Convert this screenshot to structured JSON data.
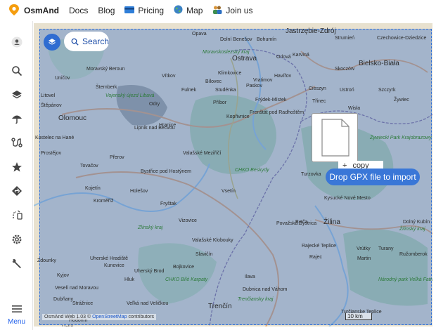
{
  "header": {
    "brand": "OsmAnd",
    "nav": [
      {
        "label": "Docs"
      },
      {
        "label": "Blog"
      },
      {
        "label": "Pricing"
      },
      {
        "label": "Map"
      },
      {
        "label": "Join us"
      }
    ]
  },
  "sidebar": {
    "menu_label": "Menu",
    "icons": [
      "account-icon",
      "search-icon",
      "layers-icon",
      "weather-icon",
      "routes-icon",
      "favorites-icon",
      "navigation-icon",
      "travel-icon",
      "settings-icon",
      "tools-icon"
    ]
  },
  "map": {
    "search_label": "Search",
    "copy_label": "copy",
    "drop_label": "Drop GPX file to import",
    "attribution_prefix": "OsmAnd Web 1.03 ©",
    "attribution_link": "OpenStreetMap",
    "attribution_suffix": "contributors",
    "scale_label": "10 km",
    "places": [
      {
        "name": "Opava",
        "cls": ""
      },
      {
        "name": "Dolní Benešov",
        "cls": ""
      },
      {
        "name": "Bohumín",
        "cls": ""
      },
      {
        "name": "Jastrzębie-Zdrój",
        "cls": "big"
      },
      {
        "name": "Strumień",
        "cls": ""
      },
      {
        "name": "Czechowice-Dziedzice",
        "cls": ""
      },
      {
        "name": "Moravskoslezský kraj",
        "cls": "park"
      },
      {
        "name": "Ostrava",
        "cls": "big"
      },
      {
        "name": "Orlová",
        "cls": ""
      },
      {
        "name": "Karviná",
        "cls": ""
      },
      {
        "name": "Bielsko-Biała",
        "cls": "big"
      },
      {
        "name": "Moravský Beroun",
        "cls": ""
      },
      {
        "name": "Vítkov",
        "cls": ""
      },
      {
        "name": "Klimkovice",
        "cls": ""
      },
      {
        "name": "Bílovec",
        "cls": ""
      },
      {
        "name": "Vratimov",
        "cls": ""
      },
      {
        "name": "Havířov",
        "cls": ""
      },
      {
        "name": "Skoczów",
        "cls": ""
      },
      {
        "name": "Uničov",
        "cls": ""
      },
      {
        "name": "Šternberk",
        "cls": ""
      },
      {
        "name": "Fulnek",
        "cls": ""
      },
      {
        "name": "Studénka",
        "cls": ""
      },
      {
        "name": "Paskov",
        "cls": ""
      },
      {
        "name": "Cieszyn",
        "cls": ""
      },
      {
        "name": "Ustroń",
        "cls": ""
      },
      {
        "name": "Szczyrk",
        "cls": ""
      },
      {
        "name": "Litovel",
        "cls": ""
      },
      {
        "name": "Vojenský újezd Libavá",
        "cls": "park"
      },
      {
        "name": "Frýdek-Místek",
        "cls": ""
      },
      {
        "name": "Třinec",
        "cls": ""
      },
      {
        "name": "Wisła",
        "cls": ""
      },
      {
        "name": "Žywiec",
        "cls": ""
      },
      {
        "name": "Štěpánov",
        "cls": ""
      },
      {
        "name": "Odry",
        "cls": ""
      },
      {
        "name": "Příbor",
        "cls": ""
      },
      {
        "name": "Olomouc",
        "cls": "big"
      },
      {
        "name": "Kopřivnice",
        "cls": ""
      },
      {
        "name": "Frenštát pod Radhoštěm",
        "cls": ""
      },
      {
        "name": "Lipník nad Bečvou",
        "cls": ""
      },
      {
        "name": "Hranice",
        "cls": ""
      },
      {
        "name": "Kostelec na Hané",
        "cls": ""
      },
      {
        "name": "Prostějov",
        "cls": ""
      },
      {
        "name": "Přerov",
        "cls": ""
      },
      {
        "name": "Valašské Meziříčí",
        "cls": ""
      },
      {
        "name": "CHKO Beskydy",
        "cls": "park"
      },
      {
        "name": "Turzovka",
        "cls": ""
      },
      {
        "name": "Żywiecki Park Krajobrazowy",
        "cls": "park"
      },
      {
        "name": "Tovačov",
        "cls": ""
      },
      {
        "name": "Bystřice pod Hostýnem",
        "cls": ""
      },
      {
        "name": "Kojetín",
        "cls": ""
      },
      {
        "name": "Holešov",
        "cls": ""
      },
      {
        "name": "Vsetín",
        "cls": ""
      },
      {
        "name": "Kroměříž",
        "cls": ""
      },
      {
        "name": "Fryštak",
        "cls": ""
      },
      {
        "name": "Kysucké Nové Mesto",
        "cls": ""
      },
      {
        "name": "Zlínský kraj",
        "cls": "park"
      },
      {
        "name": "Vizovice",
        "cls": ""
      },
      {
        "name": "Bytča",
        "cls": ""
      },
      {
        "name": "Žilina",
        "cls": "big"
      },
      {
        "name": "Žilinský kraj",
        "cls": "park"
      },
      {
        "name": "Dolný Kubín",
        "cls": ""
      },
      {
        "name": "Valašské Klobouky",
        "cls": ""
      },
      {
        "name": "Považská Bystrica",
        "cls": ""
      },
      {
        "name": "Rajecké Teplice",
        "cls": ""
      },
      {
        "name": "Vrútky",
        "cls": ""
      },
      {
        "name": "Turany",
        "cls": ""
      },
      {
        "name": "Ružomberok",
        "cls": ""
      },
      {
        "name": "Zdounky",
        "cls": ""
      },
      {
        "name": "Uherské Hradiště",
        "cls": ""
      },
      {
        "name": "Kunovice",
        "cls": ""
      },
      {
        "name": "Slavičín",
        "cls": ""
      },
      {
        "name": "Bojkovice",
        "cls": ""
      },
      {
        "name": "Uherský Brod",
        "cls": ""
      },
      {
        "name": "Rajec",
        "cls": ""
      },
      {
        "name": "Martin",
        "cls": ""
      },
      {
        "name": "Kyjov",
        "cls": ""
      },
      {
        "name": "Hluk",
        "cls": ""
      },
      {
        "name": "CHKO Bílé Karpaty",
        "cls": "park"
      },
      {
        "name": "Ilava",
        "cls": ""
      },
      {
        "name": "Veselí nad Moravou",
        "cls": ""
      },
      {
        "name": "Dubnica nad Váhom",
        "cls": ""
      },
      {
        "name": "Národný park Veľká Fatra",
        "cls": "park"
      },
      {
        "name": "Strážnice",
        "cls": ""
      },
      {
        "name": "Veľká nad Veličkou",
        "cls": ""
      },
      {
        "name": "Trenčiansky kraj",
        "cls": "park"
      },
      {
        "name": "Dubňany",
        "cls": ""
      },
      {
        "name": "Trenčín",
        "cls": "big"
      },
      {
        "name": "Turčianske Teplice",
        "cls": ""
      },
      {
        "name": "Hodonín",
        "cls": ""
      },
      {
        "name": "Holíč",
        "cls": ""
      }
    ]
  }
}
